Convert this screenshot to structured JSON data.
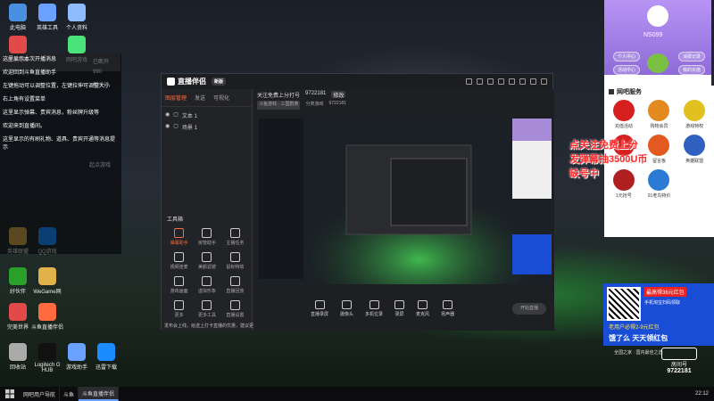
{
  "desktop": {
    "icons": [
      {
        "label": "此电脑",
        "color": "#4a90e2"
      },
      {
        "label": "英雄工具",
        "color": "#6aa0ff"
      },
      {
        "label": "个人资料",
        "color": "#8fbcff"
      },
      {
        "label": "极速网络",
        "color": "#e24a4a"
      },
      {
        "label": "网吧游戏",
        "color": "#4ae27a"
      },
      {
        "label": "英雄联盟",
        "color": "#c9a14a"
      },
      {
        "label": "QQ游戏",
        "color": "#1a8cff"
      },
      {
        "label": "好伙伴",
        "color": "#2aa02a"
      },
      {
        "label": "WeGame网",
        "color": "#e2b24a"
      },
      {
        "label": "完美世界",
        "color": "#e24a4a"
      },
      {
        "label": "斗鱼直播伴侣",
        "color": "#ff6b3d"
      },
      {
        "label": "回收站",
        "color": "#aaa"
      },
      {
        "label": "Logitech G HUB",
        "color": "#111"
      },
      {
        "label": "游戏助手",
        "color": "#6aa0ff"
      },
      {
        "label": "迅雷下载",
        "color": "#1a8cff"
      }
    ],
    "top_line": "已断开",
    "top_count": "990",
    "mid_label": "起点游戏",
    "mid_label2": "相关行"
  },
  "chat": {
    "messages": [
      "这里显示本次开播消息",
      "欢迎回到斗鱼直播助手",
      "左键拖动可以调整位置，左键拉伸可调整大小",
      "右上角有设置菜单",
      "这里显示弹幕、贵宾消息，粉丝牌升级等",
      "欢迎来到直播间。",
      "这里显示的有刷礼物、道具、贵宾开通等消息提示"
    ]
  },
  "app": {
    "name": "直播伴侣",
    "version": "新版",
    "tabs": [
      "图层管理",
      "发送",
      "可视化"
    ],
    "scenes": [
      "文本 1",
      "场景 1"
    ],
    "tools_title": "工具箱",
    "tools": [
      {
        "label": "弹幕助手",
        "hot": true
      },
      {
        "label": "房管助手",
        "hot": false
      },
      {
        "label": "主播任务",
        "hot": false
      },
      {
        "label": "视频连麦",
        "hot": false
      },
      {
        "label": "美颜滤镜",
        "hot": false
      },
      {
        "label": "鼠标特效",
        "hot": false
      },
      {
        "label": "游戏画面",
        "hot": false
      },
      {
        "label": "虚拟形象",
        "hot": false
      },
      {
        "label": "直播回放",
        "hot": false
      },
      {
        "label": "更多",
        "hot": false
      },
      {
        "label": "更多工具",
        "hot": false
      },
      {
        "label": "直播设置",
        "hot": false
      }
    ],
    "notice": "发布会上线，给送上打卡直播的优惠，建议更新到最新版本",
    "title_line": "关注免费上分打号",
    "room_id": "9722181",
    "title_chip": "修改",
    "row2_a": "斗鱼游戏 · 三国群英",
    "row2_b": "分类游戏",
    "row2_c": "9722181",
    "bottom": [
      {
        "label": "直播录屏"
      },
      {
        "label": "摄像头"
      },
      {
        "label": "多机位录"
      },
      {
        "label": "录屏"
      },
      {
        "label": "麦克风"
      },
      {
        "label": "扬声器"
      }
    ],
    "start_live": "开始直播"
  },
  "rside": {
    "username": "NS099",
    "buttons": [
      "个人中心",
      "消费记录",
      "活动中心",
      "我的充值"
    ]
  },
  "wangba": {
    "title": "网吧服务",
    "items": [
      {
        "label": "充值活动",
        "color": "#d62020"
      },
      {
        "label": "购物会员",
        "color": "#e28a20"
      },
      {
        "label": "游戏特权",
        "color": "#e2c020"
      },
      {
        "label": "呼叫网管",
        "color": "#d62020"
      },
      {
        "label": "留言板",
        "color": "#e25a20"
      },
      {
        "label": "英雄联盟",
        "color": "#3060c0"
      },
      {
        "label": "1元抢号",
        "color": "#b02020"
      },
      {
        "label": "91老鸟特价",
        "color": "#2a7ad6"
      }
    ]
  },
  "promo": {
    "line1": "点关注免费上分",
    "line2": "发弹幕抽3500U币",
    "line3": "缺号中"
  },
  "ad": {
    "top": "最高得36元红包",
    "mid": "手机淘宝扫码领取",
    "mid2": "老用户必得2-9元红包",
    "brand": "饿了么 天天领红包",
    "footer": "全国之家 · 国内最佳之选"
  },
  "room": {
    "label": "房间号",
    "number": "9722181"
  },
  "taskbar": {
    "items": [
      "网吧用户导航",
      "斗鱼",
      "斗鱼直播伴侣"
    ],
    "clock": "22:12"
  }
}
